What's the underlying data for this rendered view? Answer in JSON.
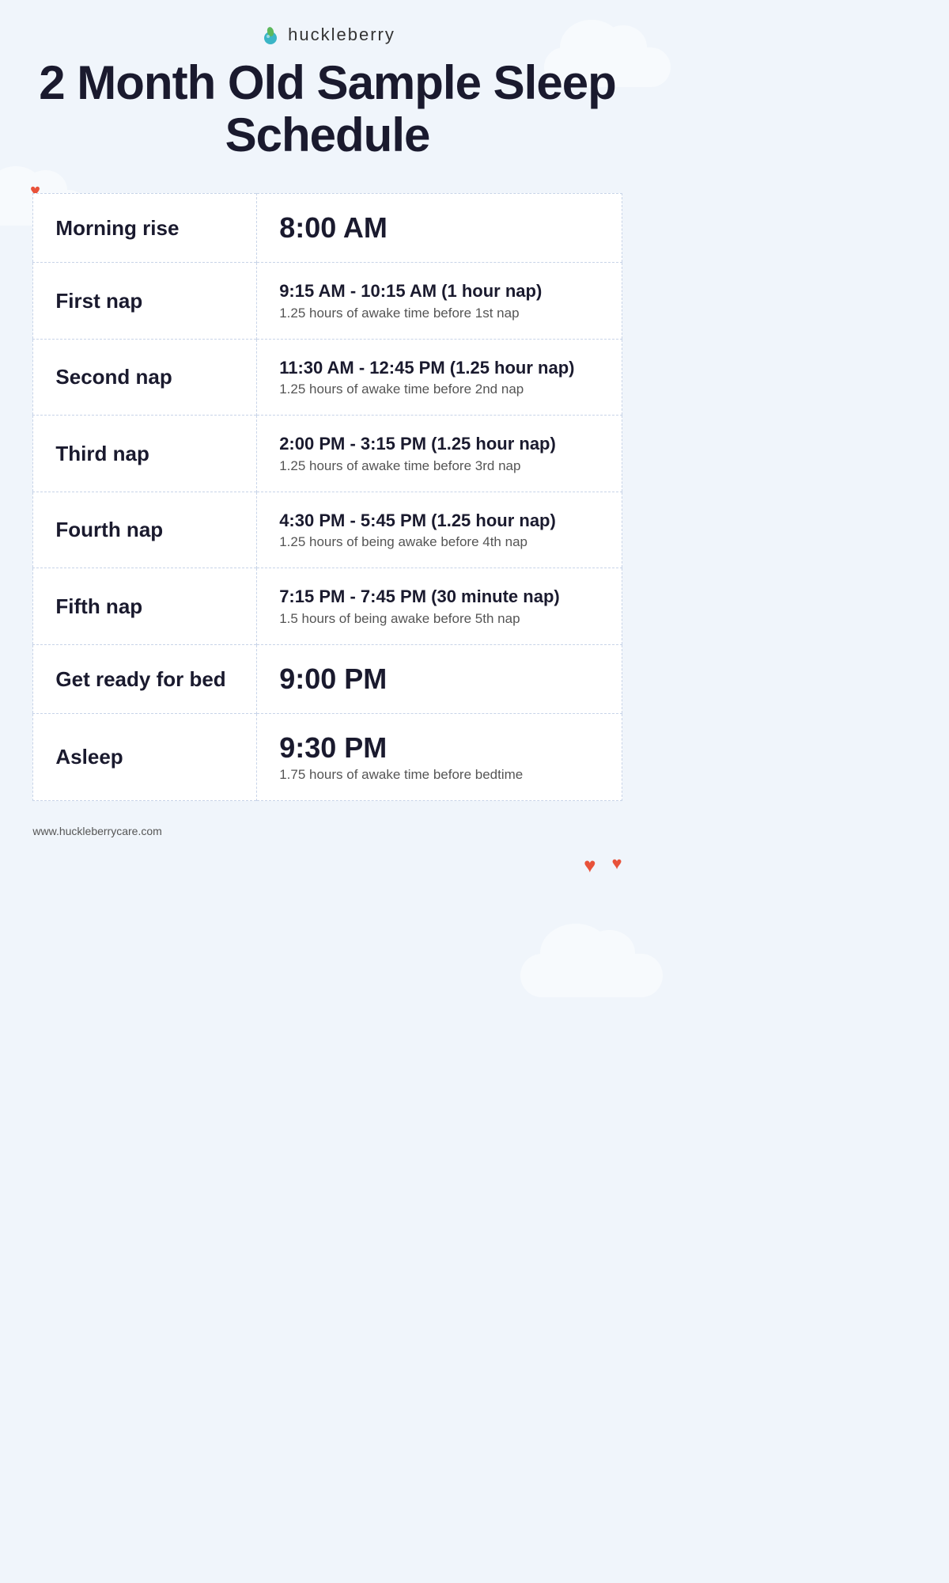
{
  "brand": {
    "name": "huckleberry"
  },
  "title": "2 Month Old Sample Sleep Schedule",
  "rows": [
    {
      "label": "Morning rise",
      "time_main": "8:00 AM",
      "time_sub": "",
      "time_note": ""
    },
    {
      "label": "First nap",
      "time_main": "",
      "time_sub": "9:15 AM - 10:15 AM (1 hour nap)",
      "time_note": "1.25 hours of awake time before 1st nap"
    },
    {
      "label": "Second nap",
      "time_main": "",
      "time_sub": "11:30 AM - 12:45 PM (1.25 hour nap)",
      "time_note": "1.25 hours of awake time before 2nd nap"
    },
    {
      "label": "Third nap",
      "time_main": "",
      "time_sub": "2:00 PM - 3:15 PM (1.25 hour nap)",
      "time_note": "1.25 hours of awake time before 3rd nap"
    },
    {
      "label": "Fourth nap",
      "time_main": "",
      "time_sub": "4:30 PM - 5:45 PM (1.25 hour nap)",
      "time_note": "1.25 hours of being awake before 4th nap"
    },
    {
      "label": "Fifth nap",
      "time_main": "",
      "time_sub": "7:15 PM - 7:45 PM (30 minute nap)",
      "time_note": "1.5 hours of being awake before 5th nap"
    },
    {
      "label": "Get ready for bed",
      "time_main": "9:00 PM",
      "time_sub": "",
      "time_note": ""
    },
    {
      "label": "Asleep",
      "time_main": "9:30 PM",
      "time_sub": "",
      "time_note": "1.75 hours of awake time before bedtime"
    }
  ],
  "footer": {
    "url": "www.huckleberrycare.com"
  },
  "hearts": {
    "small": "♥",
    "large": "♥"
  }
}
